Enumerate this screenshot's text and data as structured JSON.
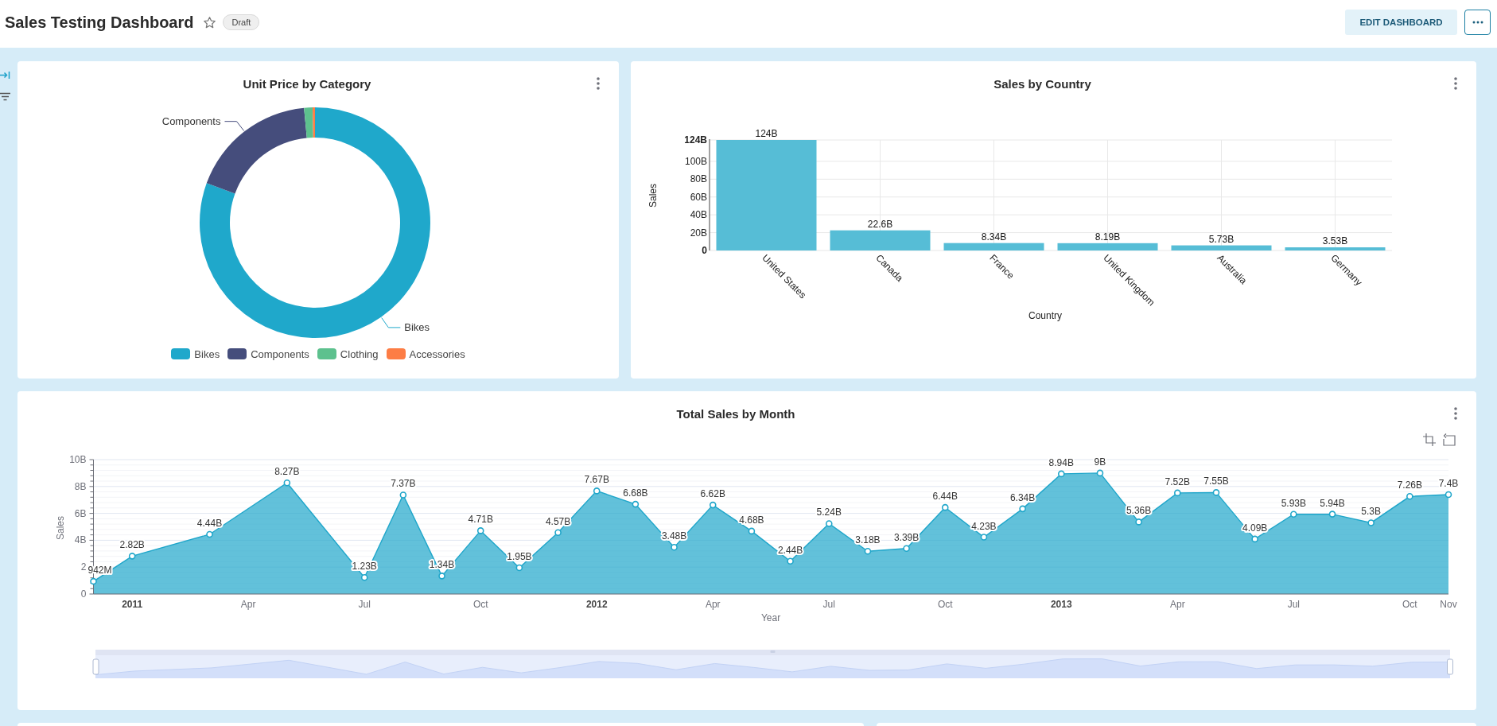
{
  "header": {
    "title": "Sales Testing Dashboard",
    "starred": false,
    "badge": "Draft",
    "edit_button": "EDIT DASHBOARD"
  },
  "unit_price_by_category": {
    "title": "Unit Price by Category",
    "slices": [
      {
        "label": "Bikes",
        "color": "#1fa8cb"
      },
      {
        "label": "Components",
        "color": "#454d7c"
      },
      {
        "color": "#5dc18e"
      },
      {
        "color": "#fd7d45"
      }
    ],
    "legend": [
      {
        "label": "Bikes",
        "color": "#1fa8cb"
      },
      {
        "label": "Components",
        "color": "#454d7c"
      },
      {
        "label": "Clothing",
        "color": "#5dc18e"
      },
      {
        "label": "Accessories",
        "color": "#fd7d45"
      }
    ]
  },
  "sales_by_country": {
    "title": "Sales by Country",
    "chart_data": {
      "type": "bar",
      "xlabel": "Country",
      "ylabel": "Sales",
      "categories": [
        "United States",
        "Canada",
        "France",
        "United Kingdom",
        "Australia",
        "Germany"
      ],
      "series": [
        {
          "color": "#56bdd6",
          "values": [
            124,
            22.6,
            8.34,
            8.19,
            5.73,
            3.53
          ]
        }
      ],
      "ylim": [
        0,
        124
      ],
      "yticks": [
        {
          "value": 0,
          "label": "0"
        },
        {
          "value": 20,
          "label": "20B"
        },
        {
          "value": 40,
          "label": "40B"
        },
        {
          "value": 60,
          "label": "60B"
        },
        {
          "value": 80,
          "label": "80B"
        },
        {
          "value": 100,
          "label": "100B"
        },
        {
          "value": 124,
          "label": "124B"
        }
      ],
      "grid": true,
      "value_labels": [
        "124B",
        "22.6B",
        "8.34B",
        "8.19B",
        "5.73B",
        "3.53B"
      ]
    }
  },
  "total_sales_by_month": {
    "title": "Total Sales by Month",
    "chart_data": {
      "type": "area",
      "xlabel": "Year",
      "ylabel": "Sales",
      "x": [
        "2010-12",
        "2011-01",
        "2011-03",
        "2011-05",
        "2011-07",
        "2011-08",
        "2011-09",
        "2011-10",
        "2011-11",
        "2011-12",
        "2012-01",
        "2012-02",
        "2012-03",
        "2012-04",
        "2012-05",
        "2012-06",
        "2012-07",
        "2012-08",
        "2012-09",
        "2012-10",
        "2012-11",
        "2012-12",
        "2013-01",
        "2013-02",
        "2013-03",
        "2013-04",
        "2013-05",
        "2013-06",
        "2013-07",
        "2013-08",
        "2013-09",
        "2013-10",
        "2013-11"
      ],
      "series": [
        {
          "color": "#1fa6ca",
          "values": [
            0.942,
            2.82,
            4.44,
            8.27,
            1.23,
            7.37,
            1.34,
            4.71,
            1.95,
            4.57,
            7.67,
            6.68,
            3.48,
            6.62,
            4.68,
            2.44,
            5.24,
            3.18,
            3.39,
            6.44,
            4.23,
            6.34,
            8.94,
            9,
            5.36,
            7.52,
            7.55,
            4.09,
            5.93,
            5.94,
            5.3,
            7.26,
            7.4
          ]
        }
      ],
      "xlim": [
        "2010-12",
        "2013-11"
      ],
      "ylim": [
        0,
        10
      ],
      "yticks": [
        {
          "value": 0,
          "label": "0"
        },
        {
          "value": 2,
          "label": "2"
        },
        {
          "value": 4,
          "label": "4B"
        },
        {
          "value": 6,
          "label": "6B"
        },
        {
          "value": 8,
          "label": "8B"
        },
        {
          "value": 10,
          "label": "10B"
        }
      ],
      "xticks": [
        {
          "value": "2011-01",
          "label": "2011"
        },
        {
          "value": "2011-04",
          "label": "Apr"
        },
        {
          "value": "2011-07",
          "label": "Jul"
        },
        {
          "value": "2011-10",
          "label": "Oct"
        },
        {
          "value": "2012-01",
          "label": "2012"
        },
        {
          "value": "2012-04",
          "label": "Apr"
        },
        {
          "value": "2012-07",
          "label": "Jul"
        },
        {
          "value": "2012-10",
          "label": "Oct"
        },
        {
          "value": "2013-01",
          "label": "2013"
        },
        {
          "value": "2013-04",
          "label": "Apr"
        },
        {
          "value": "2013-07",
          "label": "Jul"
        },
        {
          "value": "2013-10",
          "label": "Oct"
        },
        {
          "value": "2013-11",
          "label": "Nov"
        }
      ],
      "grid": true,
      "value_labels": [
        "942M",
        "2.82B",
        "4.44B",
        "8.27B",
        "1.23B",
        "7.37B",
        "1.34B",
        "4.71B",
        "1.95B",
        "4.57B",
        "7.67B",
        "6.68B",
        "3.48B",
        "6.62B",
        "4.68B",
        "2.44B",
        "5.24B",
        "3.18B",
        "3.39B",
        "6.44B",
        "4.23B",
        "6.34B",
        "8.94B",
        "9B",
        "5.36B",
        "7.52B",
        "7.55B",
        "4.09B",
        "5.93B",
        "5.94B",
        "5.3B",
        "7.26B",
        "7.4B"
      ]
    }
  }
}
